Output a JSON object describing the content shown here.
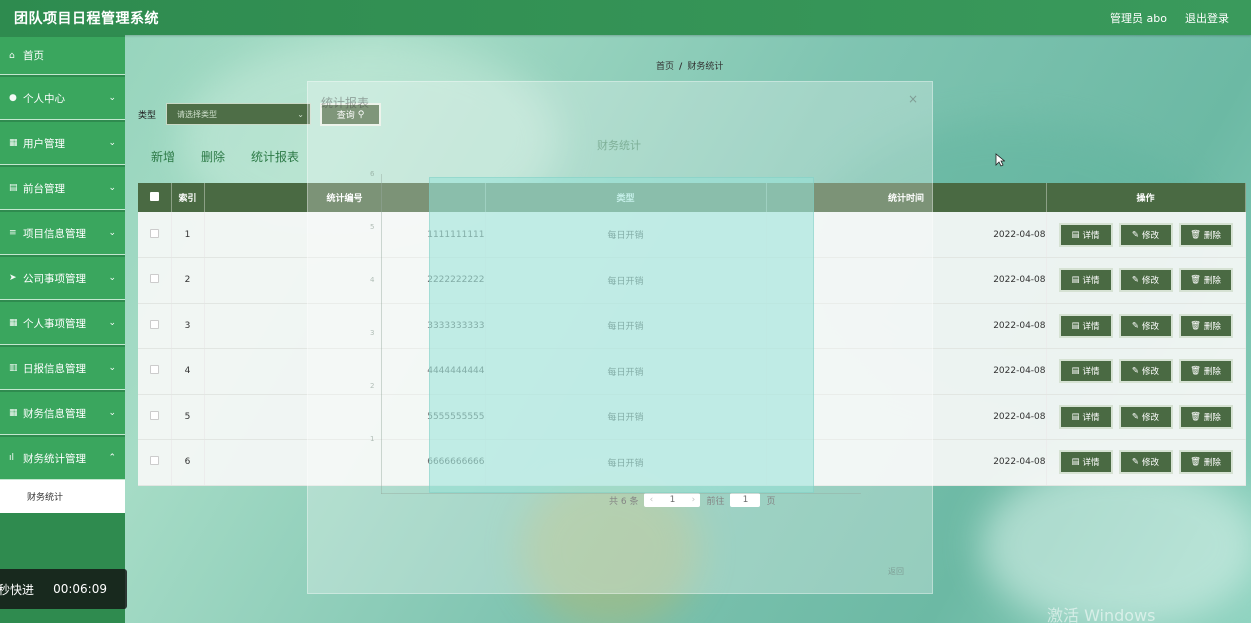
{
  "header": {
    "title": "团队项目日程管理系统",
    "user": "管理员 abo",
    "logout": "退出登录"
  },
  "sidebar": {
    "items": [
      {
        "label": "首页",
        "icon": "home-icon"
      },
      {
        "label": "个人中心",
        "icon": "user-icon"
      },
      {
        "label": "用户管理",
        "icon": "grid-icon"
      },
      {
        "label": "前台管理",
        "icon": "printer-icon"
      },
      {
        "label": "项目信息管理",
        "icon": "list-icon"
      },
      {
        "label": "公司事项管理",
        "icon": "send-icon"
      },
      {
        "label": "个人事项管理",
        "icon": "grid-icon"
      },
      {
        "label": "日报信息管理",
        "icon": "document-icon"
      },
      {
        "label": "财务信息管理",
        "icon": "grid-icon"
      },
      {
        "label": "财务统计管理",
        "icon": "bar-chart-icon"
      }
    ],
    "sub_item": "财务统计"
  },
  "video": {
    "label": "秒快进",
    "time": "00:06:09"
  },
  "breadcrumb": {
    "home": "首页",
    "current": "财务统计"
  },
  "search": {
    "label": "类型",
    "placeholder": "请选择类型",
    "button": "查询"
  },
  "actions": {
    "add": "新增",
    "delete": "删除",
    "report": "统计报表"
  },
  "table": {
    "headers": {
      "index": "索引",
      "code": "统计编号",
      "type": "类型",
      "time": "统计时间",
      "ops": "操作"
    },
    "rows": [
      {
        "index": "1",
        "code": "1111111111",
        "type": "每日开销",
        "time": "2022-04-08"
      },
      {
        "index": "2",
        "code": "2222222222",
        "type": "每日开销",
        "time": "2022-04-08"
      },
      {
        "index": "3",
        "code": "3333333333",
        "type": "每日开销",
        "time": "2022-04-08"
      },
      {
        "index": "4",
        "code": "4444444444",
        "type": "每日开销",
        "time": "2022-04-08"
      },
      {
        "index": "5",
        "code": "5555555555",
        "type": "每日开销",
        "time": "2022-04-08"
      },
      {
        "index": "6",
        "code": "6666666666",
        "type": "每日开销",
        "time": "2022-04-08"
      }
    ],
    "op_labels": {
      "detail": "详情",
      "edit": "修改",
      "delete": "删除"
    }
  },
  "pager": {
    "total": "共 6 条",
    "page": "1",
    "goto_label": "前往",
    "goto_value": "1",
    "page_suffix": "页"
  },
  "modal": {
    "title": "统计报表",
    "chart_title": "财务统计",
    "back": "返回",
    "y_ticks": [
      "6",
      "5",
      "4",
      "3",
      "2",
      "1"
    ]
  },
  "watermark": "激活 Windows",
  "colors": {
    "header": "#2e8b4f",
    "sidebar": "#3aa65e",
    "table_header": "#4a6a43",
    "button": "#4e6e47"
  }
}
